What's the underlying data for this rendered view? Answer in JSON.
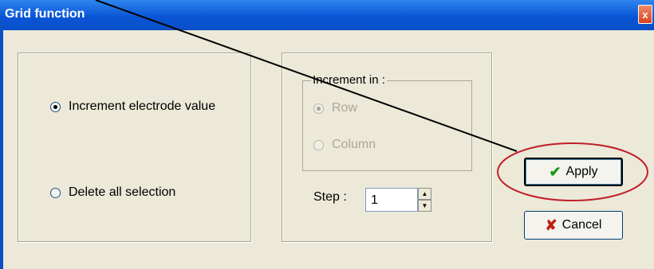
{
  "window": {
    "title": "Grid function",
    "close_label": "x"
  },
  "left_group": {
    "options": [
      {
        "label": "Increment electrode value",
        "selected": true
      },
      {
        "label": "Delete all selection",
        "selected": false
      }
    ]
  },
  "right_group": {
    "increment_legend": "Increment in :",
    "increment_options": [
      {
        "label": "Row",
        "selected": true,
        "disabled": true
      },
      {
        "label": "Column",
        "selected": false,
        "disabled": true
      }
    ],
    "step_label": "Step :",
    "step_value": "1"
  },
  "buttons": {
    "apply_label": "Apply",
    "cancel_label": "Cancel"
  },
  "icons": {
    "check": "check-icon",
    "cancel": "x-icon",
    "spin_up": "up-arrow-icon",
    "spin_down": "down-arrow-icon"
  },
  "colors": {
    "title_bar": "#0a55d6",
    "annotation": "#c0202a",
    "check": "#1a9a1a",
    "cancel_x": "#c02010"
  }
}
